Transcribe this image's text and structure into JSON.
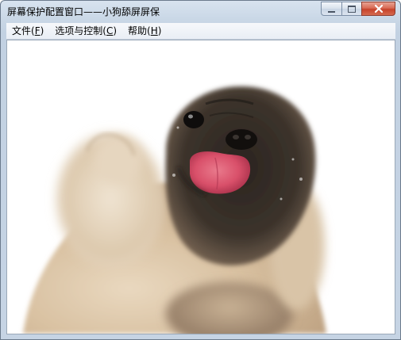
{
  "window": {
    "title": "屏幕保护配置窗口——小狗舔屏屏保"
  },
  "caption_buttons": {
    "minimize_icon": "minimize-icon",
    "maximize_icon": "maximize-icon",
    "close_icon": "close-icon"
  },
  "menu": {
    "items": [
      {
        "label": "文件(",
        "accel": "F",
        "suffix": ")"
      },
      {
        "label": "选项与控制(",
        "accel": "C",
        "suffix": ")"
      },
      {
        "label": "帮助(",
        "accel": "H",
        "suffix": ")"
      }
    ]
  },
  "content": {
    "image_subject": "pug-licking-screen"
  },
  "colors": {
    "frame": "#c6d4e4",
    "close_button": "#c7422a",
    "tongue": "#d9506a"
  }
}
